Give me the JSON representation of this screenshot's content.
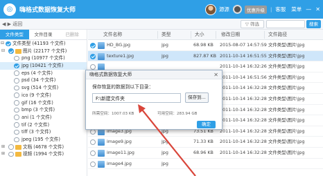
{
  "titlebar": {
    "app_title": "嗨格式数据恢复大师",
    "username": "源源",
    "vip_label": "优惠升级",
    "service": "客服",
    "menu": "菜单",
    "minimize": "—",
    "close": "✕"
  },
  "toolbar": {
    "back_label": "◀ ▶ 返回",
    "filter_label": "▽ 筛选",
    "search_placeholder": "",
    "search_label": "搜索"
  },
  "left_tabs": [
    "文件类型",
    "文件目录",
    "已删除"
  ],
  "tree": [
    {
      "label": "文件类型 (41193 个文件)",
      "level": 0,
      "checked": true,
      "expander": "⊟",
      "folder": false
    },
    {
      "label": "图片 (22177 个文件)",
      "level": 1,
      "checked": true,
      "expander": "⊟",
      "folder": true
    },
    {
      "label": "png (10977 个文件)",
      "level": 2,
      "checked": false,
      "expander": "",
      "folder": false
    },
    {
      "label": "jpg (10421 个文件)",
      "level": 2,
      "checked": true,
      "expander": "",
      "folder": false,
      "selected": true
    },
    {
      "label": "eps (4 个文件)",
      "level": 2,
      "checked": false,
      "expander": "",
      "folder": false
    },
    {
      "label": "psd (34 个文件)",
      "level": 2,
      "checked": false,
      "expander": "",
      "folder": false
    },
    {
      "label": "svg (514 个文件)",
      "level": 2,
      "checked": false,
      "expander": "",
      "folder": false
    },
    {
      "label": "ico (9 个文件)",
      "level": 2,
      "checked": false,
      "expander": "",
      "folder": false
    },
    {
      "label": "gif (16 个文件)",
      "level": 2,
      "checked": false,
      "expander": "",
      "folder": false
    },
    {
      "label": "bmp (3 个文件)",
      "level": 2,
      "checked": false,
      "expander": "",
      "folder": false
    },
    {
      "label": "ani (1 个文件)",
      "level": 2,
      "checked": false,
      "expander": "",
      "folder": false
    },
    {
      "label": "tif (2 个文件)",
      "level": 2,
      "checked": false,
      "expander": "",
      "folder": false
    },
    {
      "label": "tiff (3 个文件)",
      "level": 2,
      "checked": false,
      "expander": "",
      "folder": false
    },
    {
      "label": "jpeg (195 个文件)",
      "level": 2,
      "checked": false,
      "expander": "",
      "folder": false
    },
    {
      "label": "文档 (4678 个文件)",
      "level": 1,
      "checked": false,
      "expander": "⊞",
      "folder": true
    },
    {
      "label": "视频 (1994 个文件)",
      "level": 1,
      "checked": false,
      "expander": "⊞",
      "folder": true
    }
  ],
  "table": {
    "headers": [
      "文件名称",
      "类型",
      "大小",
      "修改日期",
      "文件路径"
    ],
    "rows": [
      {
        "name": "HD_BG.jpg",
        "type": "jpg",
        "size": "68.98 KB",
        "date": "2015-08-07 14:57:59",
        "path": "文件类型\\图片\\jpg",
        "checked": true
      },
      {
        "name": "texture1.jpg",
        "type": "jpg",
        "size": "827.87 KB",
        "date": "2011-10-14 16:51:55",
        "path": "文件类型\\图片\\jpg",
        "checked": true,
        "selected": true
      },
      {
        "name": "",
        "type": "",
        "size": "",
        "date": "2011-10-14 16:32:26",
        "path": "文件类型\\图片\\jpg",
        "checked": false
      },
      {
        "name": "",
        "type": "",
        "size": "",
        "date": "2011-10-14 16:51:56",
        "path": "文件类型\\图片\\jpg",
        "checked": false
      },
      {
        "name": "",
        "type": "",
        "size": "",
        "date": "2011-10-14 16:32:28",
        "path": "文件类型\\图片\\jpg",
        "checked": false
      },
      {
        "name": "",
        "type": "",
        "size": "",
        "date": "2011-10-14 16:32:28",
        "path": "文件类型\\图片\\jpg",
        "checked": false
      },
      {
        "name": "",
        "type": "",
        "size": "",
        "date": "2011-10-14 16:32:28",
        "path": "文件类型\\图片\\jpg",
        "checked": false
      },
      {
        "name": "",
        "type": "",
        "size": "",
        "date": "2011-10-14 16:32:28",
        "path": "文件类型\\图片\\jpg",
        "checked": false
      },
      {
        "name": "image3.jpg",
        "type": "jpg",
        "size": "73.51 KB",
        "date": "2011-10-14 16:32:28",
        "path": "文件类型\\图片\\jpg",
        "checked": false
      },
      {
        "name": "image9.jpg",
        "type": "jpg",
        "size": "71.33 KB",
        "date": "2011-10-14 16:32:28",
        "path": "文件类型\\图片\\jpg",
        "checked": false
      },
      {
        "name": "image11.jpg",
        "type": "jpg",
        "size": "68.96 KB",
        "date": "2011-10-14 16:32:28",
        "path": "文件类型\\图片\\jpg",
        "checked": false
      },
      {
        "name": "image4.jpg",
        "type": "jpg",
        "size": "",
        "date": "",
        "path": "",
        "checked": false
      }
    ]
  },
  "dialog": {
    "title": "嗨格式数据恢复大师",
    "close": "✕",
    "prompt": "保存恢复的数据到以下目录：",
    "path_value": "F:\\新建文件夹",
    "browse_label": "保存到...",
    "required_space": "所需空间：1007.03 KB",
    "available_space": "可用空间：283.94 GB",
    "ok_label": "确定"
  },
  "colors": {
    "accent": "#2f9fe6",
    "arrow": "#d9463b"
  }
}
